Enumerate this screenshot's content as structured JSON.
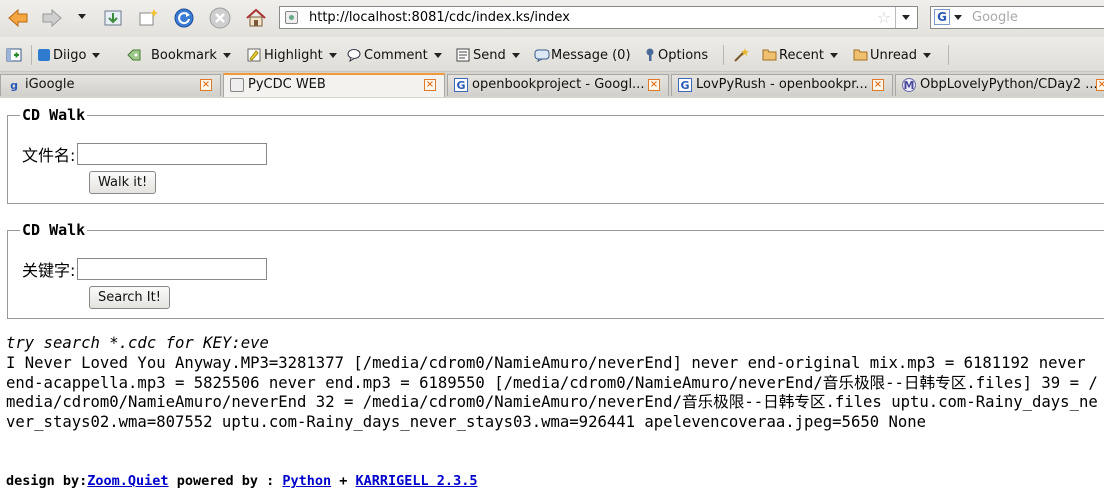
{
  "browser": {
    "url": "http://localhost:8081/cdc/index.ks/index",
    "search_placeholder": "Google",
    "search_engine_icon": "G"
  },
  "toolbar": {
    "items": [
      {
        "label": "Diigo",
        "icon": "diigo-icon"
      },
      {
        "label": "Bookmark",
        "icon": "bookmark-icon"
      },
      {
        "label": "Highlight",
        "icon": "highlight-icon"
      },
      {
        "label": "Comment",
        "icon": "comment-icon"
      },
      {
        "label": "Send",
        "icon": "send-icon"
      },
      {
        "label": "Message (0)",
        "icon": "message-icon"
      },
      {
        "label": "Options",
        "icon": "options-icon"
      },
      {
        "label": "Recent",
        "icon": "folder-icon"
      },
      {
        "label": "Unread",
        "icon": "folder-icon"
      }
    ]
  },
  "tabs": [
    {
      "label": "iGoogle",
      "icon": "G",
      "active": false
    },
    {
      "label": "PyCDC WEB",
      "icon": "page",
      "active": true
    },
    {
      "label": "openbookproject - Googl...",
      "icon": "G",
      "active": false
    },
    {
      "label": "LovPyRush - openbookpr...",
      "icon": "G",
      "active": false
    },
    {
      "label": "ObpLovelyPython/CDay2 ...",
      "icon": "moin",
      "active": false
    }
  ],
  "form_walk": {
    "legend": "CD Walk",
    "label": "文件名:",
    "value": "",
    "button": "Walk it!"
  },
  "form_search": {
    "legend": "CD Walk",
    "label": "关键字:",
    "value": "",
    "button": "Search It!"
  },
  "result": {
    "hint": "try search *.cdc for KEY:eve",
    "text": "I Never Loved You Anyway.MP3=3281377 [/media/cdrom0/NamieAmuro/neverEnd] never end-original mix.mp3 = 6181192 never end-acappella.mp3 = 5825506 never end.mp3 = 6189550 [/media/cdrom0/NamieAmuro/neverEnd/音乐极限--日韩专区.files] 39 = /media/cdrom0/NamieAmuro/neverEnd 32 = /media/cdrom0/NamieAmuro/neverEnd/音乐极限--日韩专区.files uptu.com-Rainy_days_never_stays02.wma=807552 uptu.com-Rainy_days_never_stays03.wma=926441 apelevencoveraa.jpeg=5650 None"
  },
  "footer": {
    "design_by": "design by:",
    "author": "Zoom.Quiet",
    "powered_by": " powered by : ",
    "python": "Python",
    "plus": " + ",
    "karrigell": "KARRIGELL 2.3.5"
  }
}
